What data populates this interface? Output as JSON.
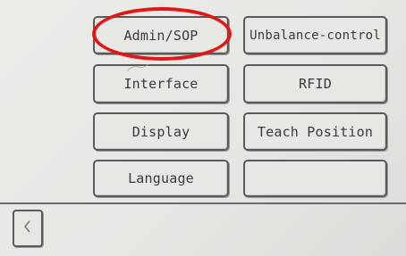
{
  "menu": {
    "buttons": [
      {
        "label": "Admin/SOP"
      },
      {
        "label": "Unbalance-control"
      },
      {
        "label": "Interface"
      },
      {
        "label": "RFID"
      },
      {
        "label": "Display"
      },
      {
        "label": "Teach Position"
      },
      {
        "label": "Language"
      },
      {
        "label": ""
      }
    ]
  },
  "footer": {
    "back_icon": "chevron-left-icon"
  },
  "annotation": {
    "highlight_color": "#e01818"
  }
}
